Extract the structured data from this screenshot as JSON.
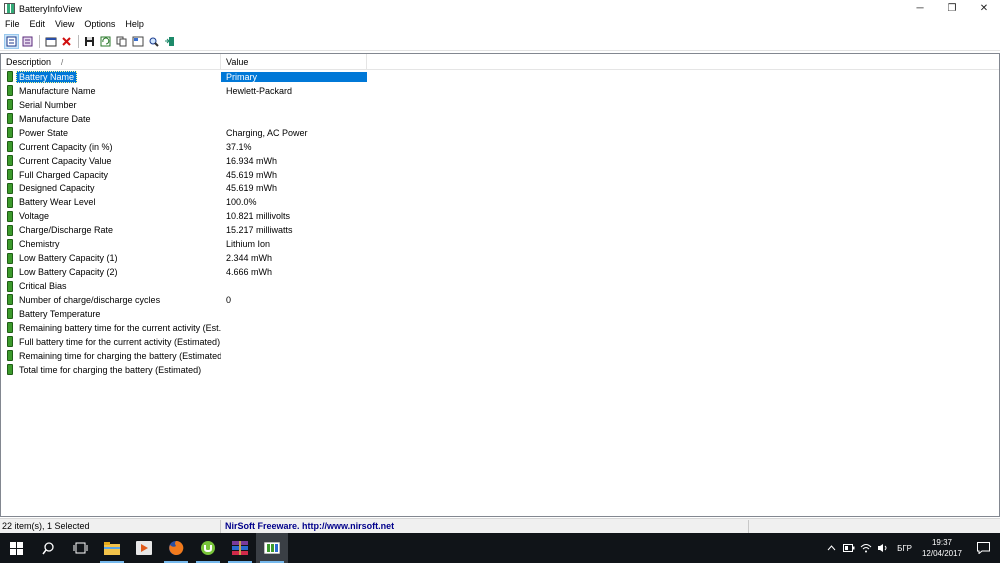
{
  "window": {
    "title": "BatteryInfoView",
    "controls": [
      "─",
      "❐",
      "✕"
    ]
  },
  "menu": [
    "File",
    "Edit",
    "View",
    "Options",
    "Help"
  ],
  "toolbar": {
    "buttons": [
      "view-mode-icon",
      "view-log-icon",
      "properties-icon",
      "delete-icon",
      "save-icon",
      "refresh-icon",
      "copy-icon",
      "html-report-icon",
      "find-icon",
      "exit-icon"
    ]
  },
  "list": {
    "columns": [
      "Description",
      "Value"
    ],
    "sort_indicator": "/",
    "rows": [
      {
        "description": "Battery Name",
        "value": "Primary"
      },
      {
        "description": "Manufacture Name",
        "value": "Hewlett-Packard"
      },
      {
        "description": "Serial Number",
        "value": ""
      },
      {
        "description": "Manufacture Date",
        "value": ""
      },
      {
        "description": "Power State",
        "value": "Charging, AC Power"
      },
      {
        "description": "Current Capacity (in %)",
        "value": "37.1%"
      },
      {
        "description": "Current Capacity Value",
        "value": "16.934 mWh"
      },
      {
        "description": "Full Charged Capacity",
        "value": "45.619 mWh"
      },
      {
        "description": "Designed Capacity",
        "value": "45.619 mWh"
      },
      {
        "description": "Battery Wear Level",
        "value": "100.0%"
      },
      {
        "description": "Voltage",
        "value": "10.821 millivolts"
      },
      {
        "description": "Charge/Discharge Rate",
        "value": "15.217 milliwatts"
      },
      {
        "description": "Chemistry",
        "value": "Lithium Ion"
      },
      {
        "description": "Low Battery Capacity (1)",
        "value": "2.344 mWh"
      },
      {
        "description": "Low Battery Capacity (2)",
        "value": "4.666 mWh"
      },
      {
        "description": "Critical Bias",
        "value": ""
      },
      {
        "description": "Number of charge/discharge cycles",
        "value": "0"
      },
      {
        "description": "Battery Temperature",
        "value": ""
      },
      {
        "description": "Remaining battery time for the current activity (Est...",
        "value": ""
      },
      {
        "description": "Full battery time for the current activity (Estimated)",
        "value": ""
      },
      {
        "description": "Remaining time for charging the battery (Estimated)",
        "value": ""
      },
      {
        "description": "Total  time for charging the battery (Estimated)",
        "value": ""
      }
    ]
  },
  "status": {
    "count": "22 item(s), 1 Selected",
    "link": "NirSoft Freeware.  http://www.nirsoft.net"
  },
  "taskbar": {
    "icons": [
      "windows-start-icon",
      "search-icon",
      "task-view-icon",
      "file-explorer-icon",
      "media-player-icon",
      "firefox-icon",
      "utorrent-icon",
      "winrar-icon",
      "batteryinfoview-icon"
    ],
    "tray": {
      "icons": [
        "chevron-up-icon",
        "battery-icon",
        "wifi-icon",
        "volume-icon"
      ],
      "language": "БГР",
      "time": "19:37",
      "date": "12/04/2017"
    }
  },
  "colors": {
    "selection": "#0078d7",
    "battery_green": "#3c9a2c",
    "link": "#00008b",
    "taskbar": "#101418"
  }
}
